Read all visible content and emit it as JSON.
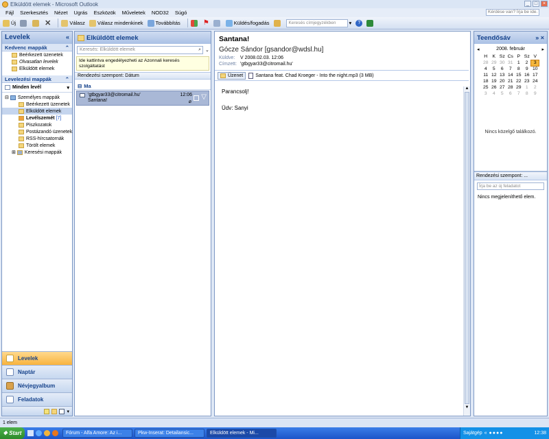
{
  "window": {
    "title": "Elküldött elemek - Microsoft Outlook"
  },
  "menu": [
    "Fájl",
    "Szerkesztés",
    "Nézet",
    "Ugrás",
    "Eszközök",
    "Műveletek",
    "NOD32",
    "Súgó"
  ],
  "help_placeholder": "Kérdése van? Írja be ide.",
  "toolbar": {
    "new": "Új",
    "reply": "Válasz",
    "reply_all": "Válasz mindenkinek",
    "forward": "Továbbítás",
    "send_receive": "Küldés/fogadás",
    "address_search": "Keresés címjegyzékben"
  },
  "nav": {
    "title": "Levelek",
    "favorites_title": "Kedvenc mappák",
    "favorites": [
      "Beérkezett üzenetek",
      "Olvasatlan levelek",
      "Elküldött elemek"
    ],
    "mail_folders_title": "Levelezési mappák",
    "all_mail": "Minden levél",
    "personal_folders": "Személyes mappák",
    "folders": [
      "Beérkezett üzenetek",
      "Elküldött elemek",
      "Levélszemét",
      "Piszkozatok",
      "Postázandó üzenetek",
      "RSS-hírcsatornák",
      "Törölt elemek",
      "Keresési mappák"
    ],
    "junk_count": "[7]",
    "buttons": [
      "Levelek",
      "Naptár",
      "Névjegyalbum",
      "Feladatok"
    ]
  },
  "list": {
    "title": "Elküldött elemek",
    "search_placeholder": "Keresés: Elküldött elemek",
    "info": "Ide kattintva engedélyezheti az Azonnali keresés szolgáltatást",
    "sort": "Rendezési szempont: Dátum",
    "group": "Ma",
    "mail": {
      "to": "'gtbgyar33@citromail.hu'",
      "subject": "Santana!",
      "time": "12:06"
    }
  },
  "reading": {
    "subject": "Santana!",
    "from": "Gócze Sándor [gsandor@wdsl.hu]",
    "sent_label": "Küldve:",
    "sent": "V 2008.02.03. 12:06",
    "to_label": "Címzett:",
    "to": "'gtbgyar33@citromail.hu'",
    "attach_msg": "Üzenet",
    "attachment": "Santana feat. Chad Kroeger - Into the night.mp3 (3 MB)",
    "body1": "Parancsolj!",
    "body2": "Üdv: Sanyi"
  },
  "todo": {
    "title": "Teendősáv",
    "month": "2008. február",
    "days": [
      "H",
      "K",
      "Sz",
      "Cs",
      "P",
      "Sz",
      "V"
    ],
    "weeks": [
      [
        "28",
        "29",
        "30",
        "31",
        "1",
        "2",
        "3"
      ],
      [
        "4",
        "5",
        "6",
        "7",
        "8",
        "9",
        "10"
      ],
      [
        "11",
        "12",
        "13",
        "14",
        "15",
        "16",
        "17"
      ],
      [
        "18",
        "19",
        "20",
        "21",
        "22",
        "23",
        "24"
      ],
      [
        "25",
        "26",
        "27",
        "28",
        "29",
        "1",
        "2"
      ],
      [
        "3",
        "4",
        "5",
        "6",
        "7",
        "8",
        "9"
      ]
    ],
    "no_appointments": "Nincs közelgő találkozó.",
    "sort": "Rendezési szempont: ...",
    "task_placeholder": "Írja be az új feladatot",
    "no_items": "Nincs megjeleníthető elem."
  },
  "status": "1 elem",
  "taskbar": {
    "start": "Start",
    "tasks": [
      "Fórum - Alfa Amore: Az i...",
      "Pkw-Inserat: Detailansic...",
      "Elküldött elemek - Mi..."
    ],
    "tray_label": "Sajátgép",
    "clock": "12:38"
  }
}
